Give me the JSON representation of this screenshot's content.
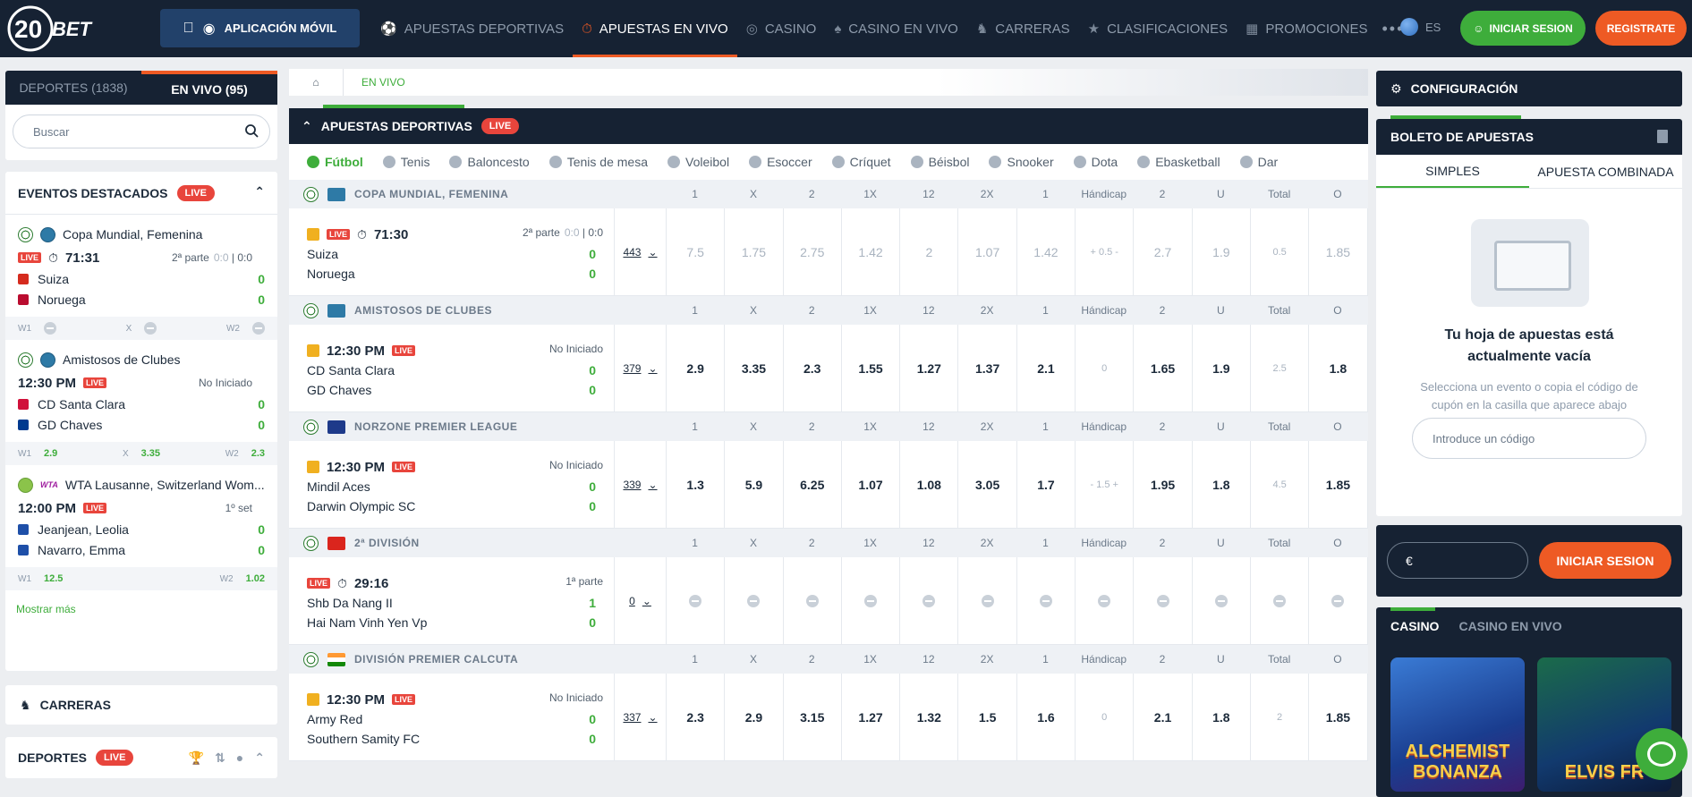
{
  "header": {
    "logo": "20BET",
    "app_link": "APLICACIÓN MÓVIL",
    "nav": [
      {
        "label": "APUESTAS DEPORTIVAS",
        "icon": "soccer-icon"
      },
      {
        "label": "APUESTAS EN VIVO",
        "icon": "stopwatch-icon",
        "active": true
      },
      {
        "label": "CASINO",
        "icon": "casino-chip-icon"
      },
      {
        "label": "CASINO EN VIVO",
        "icon": "cards-icon"
      },
      {
        "label": "CARRERAS",
        "icon": "horse-icon"
      },
      {
        "label": "CLASIFICACIONES",
        "icon": "trophy-icon"
      },
      {
        "label": "PROMOCIONES",
        "icon": "gift-icon"
      }
    ],
    "lang": "ES",
    "login": "INICIAR SESION",
    "register": "REGISTRATE"
  },
  "left": {
    "tab_sports": "DEPORTES (1838)",
    "tab_live": "EN VIVO (95)",
    "search_placeholder": "Buscar",
    "featured_title": "EVENTOS DESTACADOS",
    "live": "LIVE",
    "events": [
      {
        "league": "Copa Mundial, Femenina",
        "time": "71:31",
        "status": "2ª parte",
        "status_score1": "0:0",
        "status_score2": "0:0",
        "home": "Suiza",
        "away": "Noruega",
        "home_score": "0",
        "away_score": "0",
        "w1": "W1",
        "x": "X",
        "w2": "W2"
      },
      {
        "league": "Amistosos de Clubes",
        "time": "12:30 PM",
        "status": "No Iniciado",
        "home": "CD Santa Clara",
        "away": "GD Chaves",
        "home_score": "0",
        "away_score": "0",
        "w1": "W1",
        "o1": "2.9",
        "x": "X",
        "ox": "3.35",
        "w2": "W2",
        "o2": "2.3"
      },
      {
        "league": "WTA Lausanne, Switzerland Wom...",
        "tour": "WTA",
        "time": "12:00 PM",
        "status": "1º set",
        "home": "Jeanjean, Leolia",
        "away": "Navarro, Emma",
        "home_score": "0",
        "away_score": "0",
        "w1": "W1",
        "o1": "12.5",
        "w2": "W2",
        "o2": "1.02"
      }
    ],
    "show_more": "Mostrar más",
    "racing": "CARRERAS",
    "sports": "DEPORTES"
  },
  "center": {
    "crumb": "EN VIVO",
    "section": "APUESTAS DEPORTIVAS",
    "sports": [
      "Fútbol",
      "Tenis",
      "Baloncesto",
      "Tenis de mesa",
      "Voleibol",
      "Esoccer",
      "Críquet",
      "Béisbol",
      "Snooker",
      "Dota",
      "Ebasketball",
      "Dar"
    ],
    "cols": [
      "1",
      "X",
      "2",
      "1X",
      "12",
      "2X",
      "1",
      "Hándicap",
      "2",
      "U",
      "Total",
      "O"
    ],
    "leagues": [
      {
        "name": "COPA MUNDIAL, FEMENINA",
        "flag": "world",
        "status": "2ª parte",
        "s1": "0:0",
        "s2": "0:0",
        "time": "71:30",
        "home": "Suiza",
        "away": "Noruega",
        "hs": "0",
        "as": "0",
        "count": "443",
        "odds": [
          "7.5",
          "1.75",
          "2.75",
          "1.42",
          "2",
          "1.07",
          "1.42",
          "+ 0.5 -",
          "2.7",
          "1.9",
          "0.5",
          "1.85"
        ],
        "dim": true
      },
      {
        "name": "AMISTOSOS DE CLUBES",
        "flag": "world",
        "status": "No Iniciado",
        "time": "12:30 PM",
        "home": "CD Santa Clara",
        "away": "GD Chaves",
        "hs": "0",
        "as": "0",
        "count": "379",
        "odds": [
          "2.9",
          "3.35",
          "2.3",
          "1.55",
          "1.27",
          "1.37",
          "2.1",
          "0",
          "1.65",
          "1.9",
          "2.5",
          "1.8"
        ]
      },
      {
        "name": "NORZONE PREMIER LEAGUE",
        "flag": "au",
        "status": "No Iniciado",
        "time": "12:30 PM",
        "home": "Mindil Aces",
        "away": "Darwin Olympic SC",
        "hs": "0",
        "as": "0",
        "count": "339",
        "odds": [
          "1.3",
          "5.9",
          "6.25",
          "1.07",
          "1.08",
          "3.05",
          "1.7",
          "- 1.5 +",
          "1.95",
          "1.8",
          "4.5",
          "1.85"
        ]
      },
      {
        "name": "2ª DIVISIÓN",
        "flag": "vn",
        "status": "1ª parte",
        "time": "29:16",
        "home": "Shb Da Nang II",
        "away": "Hai Nam Vinh Yen Vp",
        "hs": "1",
        "as": "0",
        "count": "0",
        "odds": [],
        "locked": true
      },
      {
        "name": "DIVISIÓN PREMIER CALCUTA",
        "flag": "in",
        "status": "No Iniciado",
        "time": "12:30 PM",
        "home": "Army Red",
        "away": "Southern Samity FC",
        "hs": "0",
        "as": "0",
        "count": "337",
        "odds": [
          "2.3",
          "2.9",
          "3.15",
          "1.27",
          "1.32",
          "1.5",
          "1.6",
          "0",
          "2.1",
          "1.8",
          "2",
          "1.85"
        ]
      }
    ]
  },
  "right": {
    "config": "CONFIGURACIÓN",
    "slip": "BOLETO DE APUESTAS",
    "tab_single": "SIMPLES",
    "tab_combo": "APUESTA COMBINADA",
    "empty_title": "Tu hoja de apuestas está actualmente vacía",
    "empty_sub": "Selecciona un evento o copia el código de cupón en la casilla que aparece abajo",
    "code_placeholder": "Introduce un código",
    "currency": "€",
    "login": "INICIAR SESION",
    "casino_tab": "CASINO",
    "casino_live_tab": "CASINO EN VIVO",
    "game1": "ALCHEMIST BONANZA",
    "game2": "ELVIS FR"
  }
}
